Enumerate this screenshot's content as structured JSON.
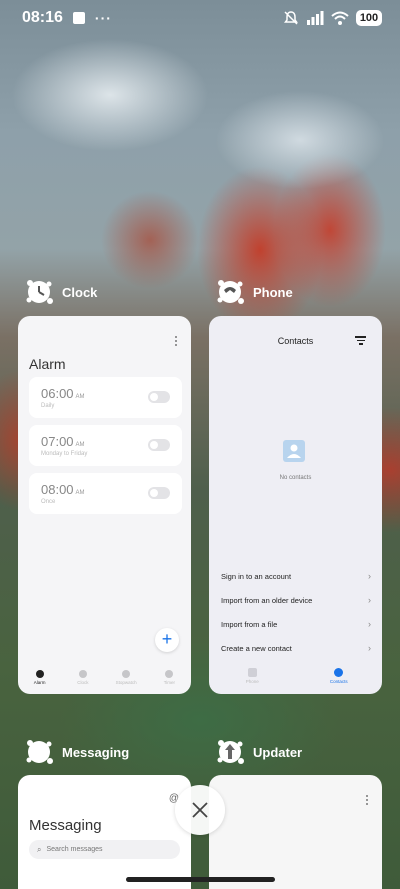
{
  "status_bar": {
    "time": "08:16",
    "battery": "100"
  },
  "apps": [
    {
      "name": "Clock"
    },
    {
      "name": "Phone"
    },
    {
      "name": "Messaging"
    },
    {
      "name": "Updater"
    }
  ],
  "clock": {
    "title": "Alarm",
    "alarms": [
      {
        "time": "06:00",
        "ampm": "AM",
        "sub": "Daily"
      },
      {
        "time": "07:00",
        "ampm": "AM",
        "sub": "Monday to Friday"
      },
      {
        "time": "08:00",
        "ampm": "AM",
        "sub": "Once"
      }
    ],
    "nav": [
      "Alarm",
      "Clock",
      "Stopwatch",
      "Timer"
    ]
  },
  "phone": {
    "title": "Contacts",
    "empty_text": "No contacts",
    "actions": [
      "Sign in to an account",
      "Import from an older device",
      "Import from a file",
      "Create a new contact"
    ],
    "nav": [
      "Phone",
      "Contacts"
    ]
  },
  "messaging": {
    "title": "Messaging",
    "search_placeholder": "Search messages"
  }
}
